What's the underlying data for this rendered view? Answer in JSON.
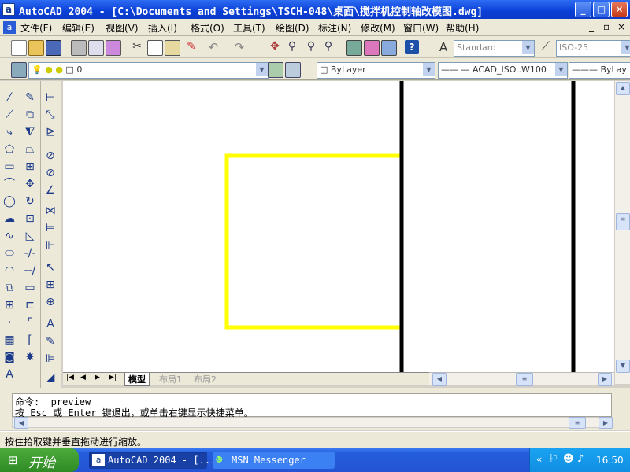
{
  "window": {
    "app_icon": "a",
    "title": "AutoCAD 2004 - [C:\\Documents and Settings\\TSCH-048\\桌面\\搅拌机控制轴改模图.dwg]",
    "buttons": [
      "_",
      "□",
      "✕"
    ]
  },
  "menu": {
    "items": [
      "文件(F)",
      "编辑(E)",
      "视图(V)",
      "插入(I)",
      "格式(O)",
      "工具(T)",
      "绘图(D)",
      "标注(N)",
      "修改(M)",
      "窗口(W)",
      "帮助(H)"
    ],
    "doc_buttons": [
      "_",
      "▫",
      "×"
    ]
  },
  "toolbar": {
    "text_style": "Standard",
    "dim_style": "ISO-25",
    "layer": "0",
    "color": "ByLayer",
    "linetype": "ACAD_ISO..W100",
    "lineweight": "ByLay"
  },
  "layout_tabs": {
    "items": [
      "模型",
      "布局1",
      "布局2"
    ],
    "active": 0
  },
  "command": {
    "line1": "命令: _preview",
    "line2": "按 Esc 或 Enter 键退出，或单击右键显示快捷菜单。"
  },
  "status": {
    "text": "按住拾取键并垂直拖动进行缩放。"
  },
  "taskbar": {
    "start_label": "开始",
    "tasks": [
      "AutoCAD 2004 - [...",
      "MSN Messenger"
    ],
    "clock": "16:50"
  },
  "colors": {
    "drawing_yellow": "#ffff00",
    "drawing_black": "#000000",
    "titlebar": "#0a3fd6"
  }
}
